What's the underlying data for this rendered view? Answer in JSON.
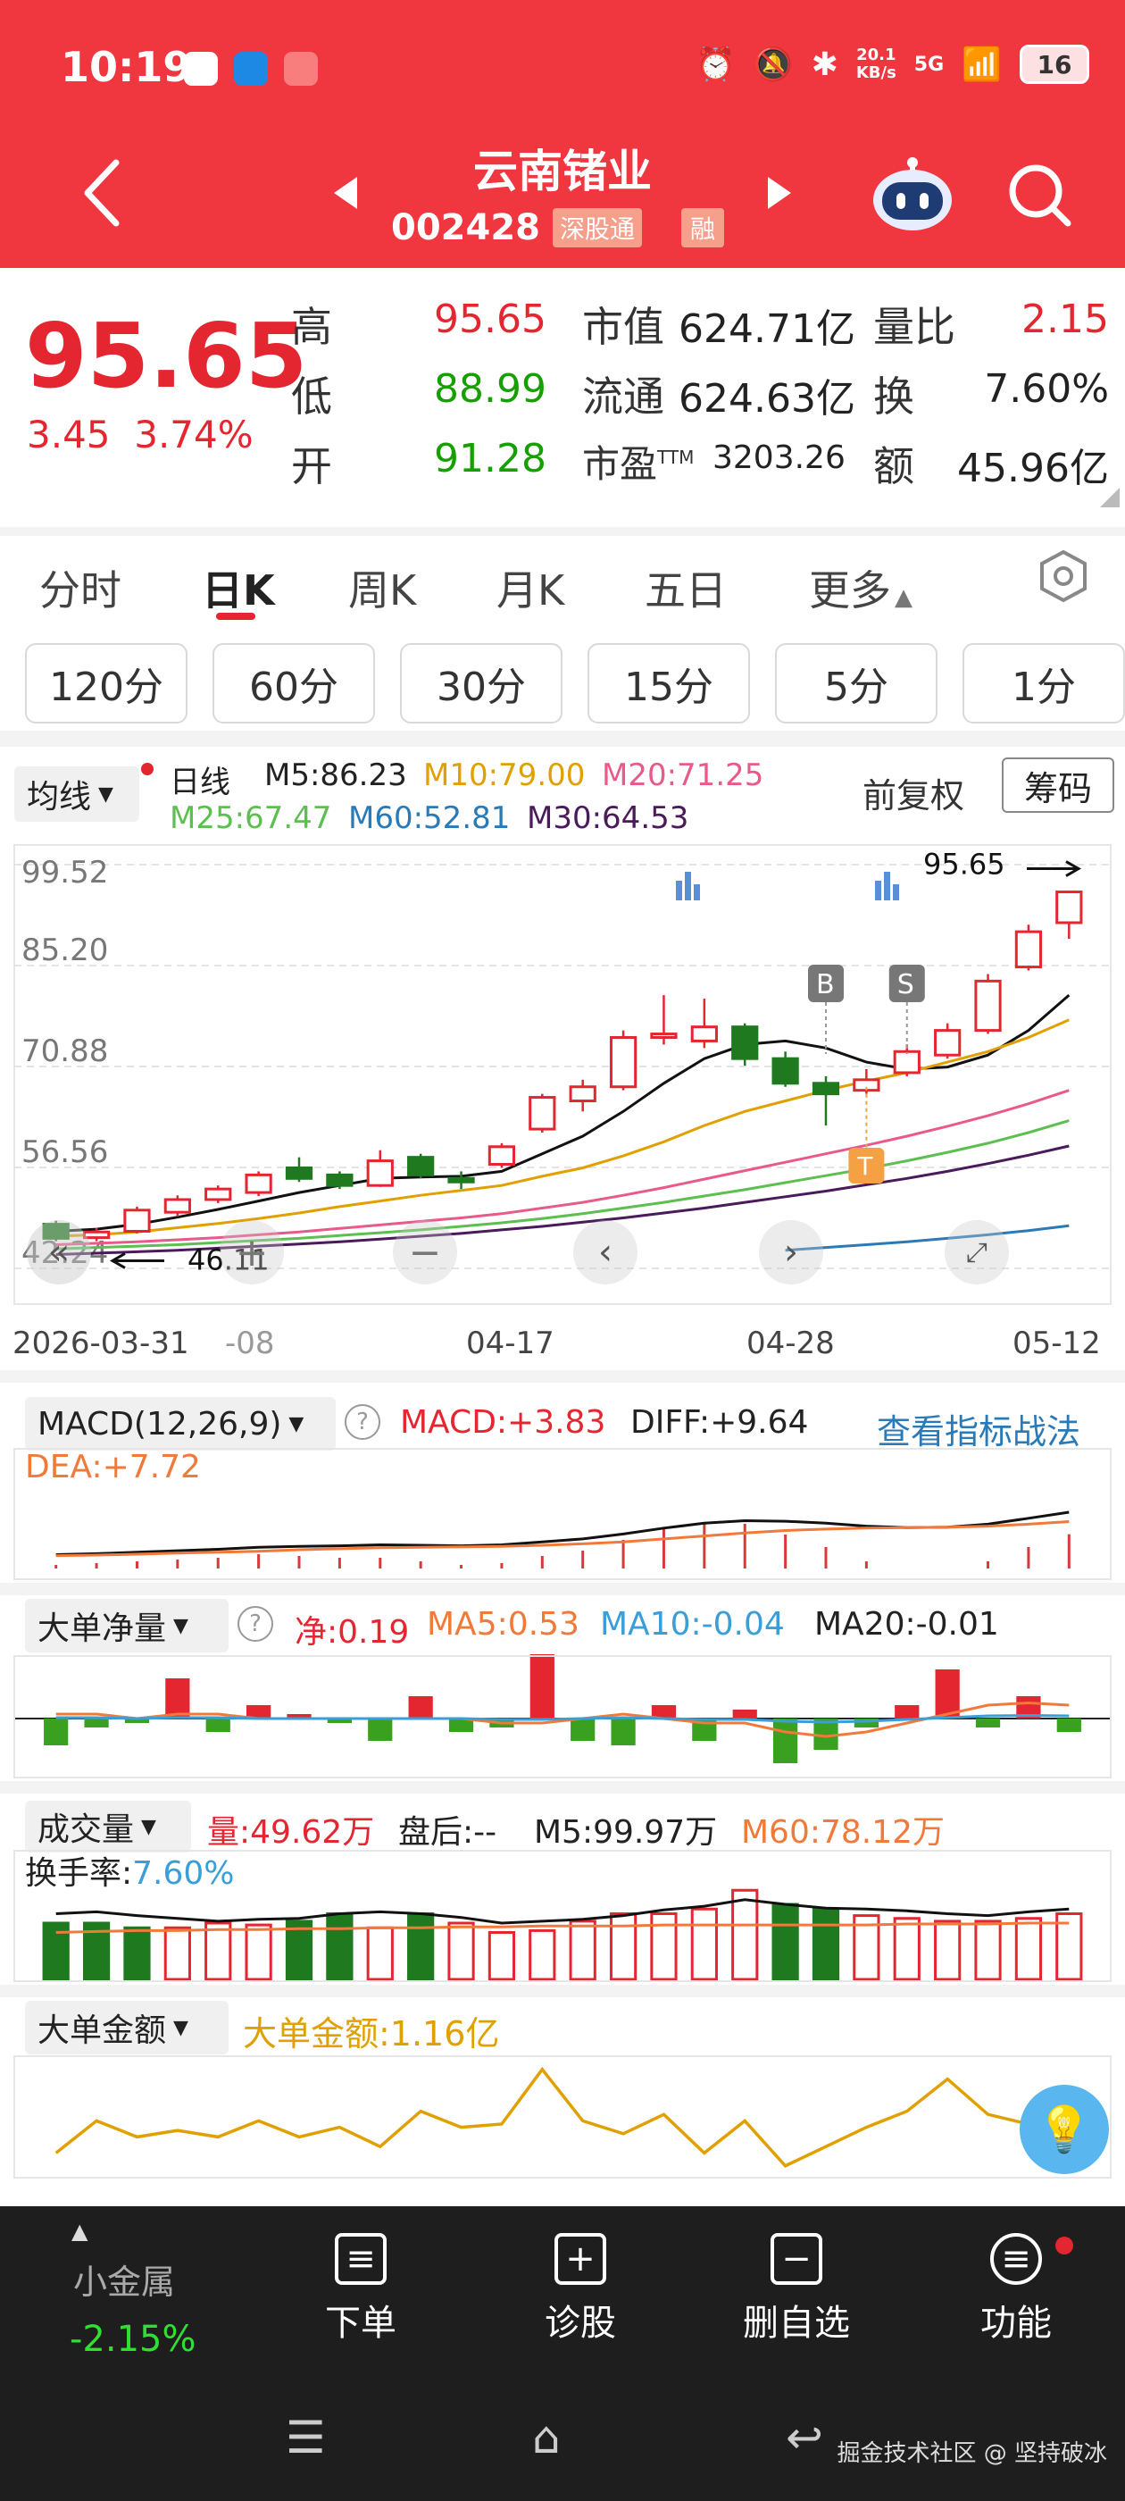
{
  "status": {
    "time": "10:19",
    "net_speed_top": "20.1",
    "net_speed_bottom": "KB/s",
    "battery": "16",
    "signal": "5G"
  },
  "header": {
    "title": "云南锗业",
    "code": "002428",
    "tag1": "深股通",
    "tag2": "融"
  },
  "quote": {
    "price": "95.65",
    "change": "3.45",
    "change_pct": "3.74%",
    "high_label": "高",
    "high": "95.65",
    "low_label": "低",
    "low": "88.99",
    "open_label": "开",
    "open": "91.28",
    "mktcap_label": "市值",
    "mktcap": "624.71亿",
    "float_label": "流通",
    "float": "624.63亿",
    "pe_label": "市盈",
    "pe_sup": "TTM",
    "pe": "3203.26",
    "volratio_label": "量比",
    "volratio": "2.15",
    "turnover_label": "换",
    "turnover": "7.60%",
    "amount_label": "额",
    "amount": "45.96亿"
  },
  "tabs": [
    "分时",
    "日K",
    "周K",
    "月K",
    "五日",
    "更多"
  ],
  "periods": [
    "120分",
    "60分",
    "30分",
    "15分",
    "5分",
    "1分"
  ],
  "kline": {
    "ma_select": "均线",
    "series_label": "日线",
    "m5": "M5:86.23",
    "m10": "M10:79.00",
    "m20": "M20:71.25",
    "m25": "M25:67.47",
    "m60": "M60:52.81",
    "m30": "M30:64.53",
    "adjust": "前复权",
    "chips": "筹码",
    "y_labels": [
      "99.52",
      "85.20",
      "70.88",
      "56.56",
      "42.24"
    ],
    "x_labels": [
      "2026-03-31",
      "-08",
      "04-17",
      "04-28",
      "05-12"
    ],
    "high_mark": "95.65",
    "low_mark": "46.11",
    "marker_b": "B",
    "marker_s": "S",
    "marker_t": "T"
  },
  "macd": {
    "name": "MACD(12,26,9)",
    "macd": "MACD:+3.83",
    "diff": "DIFF:+9.64",
    "dea": "DEA:+7.72",
    "link": "查看指标战法"
  },
  "bignet": {
    "name": "大单净量",
    "net": "净:0.19",
    "ma5": "MA5:0.53",
    "ma10": "MA10:-0.04",
    "ma20": "MA20:-0.01"
  },
  "volume": {
    "name": "成交量",
    "vol": "量:49.62万",
    "after": "盘后:-- ",
    "m5": "M5:99.97万",
    "m60": "M60:78.12万",
    "turnover_label": "换手率:",
    "turnover": "7.60%"
  },
  "bigamt": {
    "name": "大单金额",
    "amt": "大单金额:1.16亿"
  },
  "colors": {
    "red": "#e3262f",
    "green": "#16a000",
    "header": "#f0363f"
  },
  "chart_data": {
    "type": "candlestick",
    "title": "",
    "ylim": [
      42.24,
      99.52
    ],
    "y_ticks": [
      99.52,
      85.2,
      70.88,
      56.56,
      42.24
    ],
    "candles": [
      {
        "o": 48.5,
        "c": 46.5,
        "h": 49.0,
        "l": 46.1
      },
      {
        "o": 46.6,
        "c": 47.4,
        "h": 48.0,
        "l": 46.11
      },
      {
        "o": 47.5,
        "c": 50.5,
        "h": 51.0,
        "l": 47.2
      },
      {
        "o": 50.2,
        "c": 52.0,
        "h": 52.6,
        "l": 49.6
      },
      {
        "o": 52.0,
        "c": 53.5,
        "h": 54.0,
        "l": 51.5
      },
      {
        "o": 53.0,
        "c": 55.5,
        "h": 56.0,
        "l": 52.5
      },
      {
        "o": 56.5,
        "c": 55.0,
        "h": 58.0,
        "l": 54.5
      },
      {
        "o": 55.5,
        "c": 54.0,
        "h": 56.0,
        "l": 53.5
      },
      {
        "o": 54.0,
        "c": 57.5,
        "h": 59.0,
        "l": 53.8
      },
      {
        "o": 58.0,
        "c": 55.5,
        "h": 58.5,
        "l": 55.0
      },
      {
        "o": 55.0,
        "c": 54.5,
        "h": 56.0,
        "l": 53.5
      },
      {
        "o": 57.0,
        "c": 59.5,
        "h": 60.0,
        "l": 56.5
      },
      {
        "o": 62.0,
        "c": 66.5,
        "h": 67.0,
        "l": 61.5
      },
      {
        "o": 66.0,
        "c": 68.0,
        "h": 69.0,
        "l": 64.5
      },
      {
        "o": 68.0,
        "c": 75.0,
        "h": 76.0,
        "l": 67.5
      },
      {
        "o": 75.0,
        "c": 75.5,
        "h": 81.0,
        "l": 74.0
      },
      {
        "o": 74.5,
        "c": 76.5,
        "h": 80.5,
        "l": 73.5
      },
      {
        "o": 76.5,
        "c": 72.0,
        "h": 77.0,
        "l": 71.0
      },
      {
        "o": 72.0,
        "c": 68.5,
        "h": 73.0,
        "l": 68.0
      },
      {
        "o": 68.5,
        "c": 67.0,
        "h": 69.5,
        "l": 62.5
      },
      {
        "o": 67.5,
        "c": 69.0,
        "h": 70.5,
        "l": 67.0
      },
      {
        "o": 70.0,
        "c": 73.0,
        "h": 74.0,
        "l": 69.5
      },
      {
        "o": 72.5,
        "c": 76.0,
        "h": 77.0,
        "l": 72.0
      },
      {
        "o": 76.0,
        "c": 83.0,
        "h": 84.0,
        "l": 75.5
      },
      {
        "o": 85.0,
        "c": 90.0,
        "h": 91.0,
        "l": 84.5
      },
      {
        "o": 91.28,
        "c": 95.65,
        "h": 95.65,
        "l": 88.99
      }
    ],
    "ma_series": [
      {
        "name": "M5",
        "color": "#111111",
        "values": [
          47.5,
          47.8,
          48.5,
          49.5,
          50.6,
          51.8,
          53.0,
          54.0,
          55.0,
          55.2,
          55.3,
          56.0,
          58.5,
          61.0,
          64.5,
          68.5,
          72.0,
          74.0,
          74.5,
          73.5,
          71.5,
          70.5,
          70.8,
          72.5,
          76.0,
          81.0
        ]
      },
      {
        "name": "M10",
        "color": "#e0a000",
        "values": [
          46.8,
          47.0,
          47.4,
          48.0,
          48.6,
          49.3,
          50.1,
          51.0,
          51.8,
          52.6,
          53.3,
          54.0,
          55.3,
          56.5,
          58.2,
          60.2,
          62.5,
          64.5,
          66.0,
          67.5,
          68.8,
          70.0,
          71.5,
          73.0,
          75.0,
          77.5
        ]
      },
      {
        "name": "M20",
        "color": "#e85a8a",
        "values": [
          45.6,
          45.8,
          46.0,
          46.3,
          46.6,
          47.0,
          47.4,
          47.9,
          48.4,
          48.9,
          49.4,
          50.0,
          50.8,
          51.6,
          52.6,
          53.7,
          54.9,
          56.1,
          57.3,
          58.5,
          59.7,
          61.0,
          62.4,
          63.9,
          65.6,
          67.5
        ]
      },
      {
        "name": "M25",
        "color": "#5cbf50",
        "values": [
          45.0,
          45.2,
          45.4,
          45.6,
          45.9,
          46.2,
          46.5,
          46.9,
          47.3,
          47.7,
          48.2,
          48.7,
          49.3,
          50.0,
          50.8,
          51.6,
          52.5,
          53.4,
          54.4,
          55.4,
          56.4,
          57.5,
          58.7,
          60.0,
          61.5,
          63.2
        ]
      },
      {
        "name": "M30",
        "color": "#4a1a5a",
        "values": [
          44.2,
          44.4,
          44.6,
          44.8,
          45.1,
          45.4,
          45.7,
          46.0,
          46.4,
          46.8,
          47.2,
          47.7,
          48.2,
          48.8,
          49.4,
          50.1,
          50.8,
          51.6,
          52.4,
          53.2,
          54.1,
          55.0,
          56.0,
          57.1,
          58.3,
          59.6
        ]
      },
      {
        "name": "M60",
        "color": "#2a7ab8",
        "values": [
          null,
          null,
          null,
          null,
          null,
          null,
          null,
          null,
          null,
          null,
          null,
          null,
          null,
          null,
          null,
          null,
          null,
          null,
          44.8,
          45.2,
          45.6,
          46.0,
          46.5,
          47.0,
          47.6,
          48.3
        ]
      }
    ],
    "macd": {
      "diff": [
        1,
        1.2,
        1.5,
        1.8,
        2.1,
        2.5,
        2.7,
        2.8,
        3.0,
        2.9,
        2.8,
        3.0,
        3.6,
        4.2,
        5.2,
        6.4,
        7.4,
        7.9,
        7.8,
        7.4,
        6.8,
        6.5,
        6.6,
        7.2,
        8.4,
        9.64
      ],
      "dea": [
        0.8,
        0.9,
        1.1,
        1.3,
        1.5,
        1.7,
        2.0,
        2.2,
        2.4,
        2.5,
        2.6,
        2.7,
        2.9,
        3.2,
        3.6,
        4.2,
        4.8,
        5.4,
        5.9,
        6.2,
        6.4,
        6.5,
        6.6,
        6.8,
        7.2,
        7.72
      ],
      "hist": [
        0.4,
        0.6,
        0.8,
        1.0,
        1.2,
        1.6,
        1.4,
        1.2,
        1.2,
        0.8,
        0.4,
        0.6,
        1.4,
        2.0,
        3.2,
        4.4,
        5.2,
        5.0,
        3.8,
        2.4,
        0.8,
        0.0,
        0.0,
        0.8,
        2.4,
        3.83
      ]
    },
    "bignet": {
      "values": [
        -0.6,
        -0.2,
        -0.1,
        0.9,
        -0.3,
        0.3,
        0.1,
        -0.1,
        -0.5,
        0.5,
        -0.3,
        -0.2,
        1.6,
        -0.5,
        -0.6,
        0.3,
        -0.5,
        0.2,
        -1.0,
        -0.7,
        -0.2,
        0.3,
        1.1,
        -0.2,
        0.5,
        -0.3
      ],
      "ma": [
        0.1,
        0.1,
        0.0,
        0.1,
        0.1,
        0.0,
        0.0,
        0.0,
        0.0,
        0.0,
        0.0,
        -0.1,
        -0.1,
        0.0,
        0.1,
        0.0,
        -0.1,
        -0.1,
        -0.3,
        -0.4,
        -0.3,
        -0.1,
        0.1,
        0.3,
        0.35,
        0.3
      ]
    },
    "volume": {
      "values": [
        60,
        60,
        55,
        55,
        60,
        58,
        62,
        70,
        55,
        70,
        60,
        50,
        52,
        62,
        70,
        70,
        75,
        95,
        80,
        75,
        68,
        65,
        62,
        62,
        65,
        70
      ],
      "up": [
        false,
        false,
        false,
        true,
        true,
        true,
        false,
        false,
        true,
        false,
        true,
        true,
        true,
        true,
        true,
        true,
        true,
        true,
        false,
        false,
        true,
        true,
        true,
        true,
        true,
        true
      ],
      "m5": [
        70,
        72,
        68,
        65,
        62,
        64,
        65,
        70,
        72,
        70,
        66,
        60,
        62,
        64,
        68,
        74,
        78,
        85,
        80,
        76,
        75,
        73,
        70,
        68,
        72,
        75
      ],
      "m60": [
        50,
        51,
        52,
        52,
        53,
        53,
        54,
        54,
        55,
        55,
        56,
        56,
        57,
        57,
        57,
        58,
        58,
        58,
        58,
        58,
        58,
        59,
        59,
        59,
        60,
        60
      ]
    },
    "bigamt": {
      "values": [
        0.3,
        0.8,
        0.55,
        0.65,
        0.55,
        0.8,
        0.55,
        0.7,
        0.4,
        0.95,
        0.7,
        0.75,
        1.6,
        0.8,
        0.6,
        0.9,
        0.3,
        0.8,
        0.1,
        0.4,
        0.7,
        0.95,
        1.45,
        0.9,
        0.75,
        1.16
      ]
    }
  }
}
